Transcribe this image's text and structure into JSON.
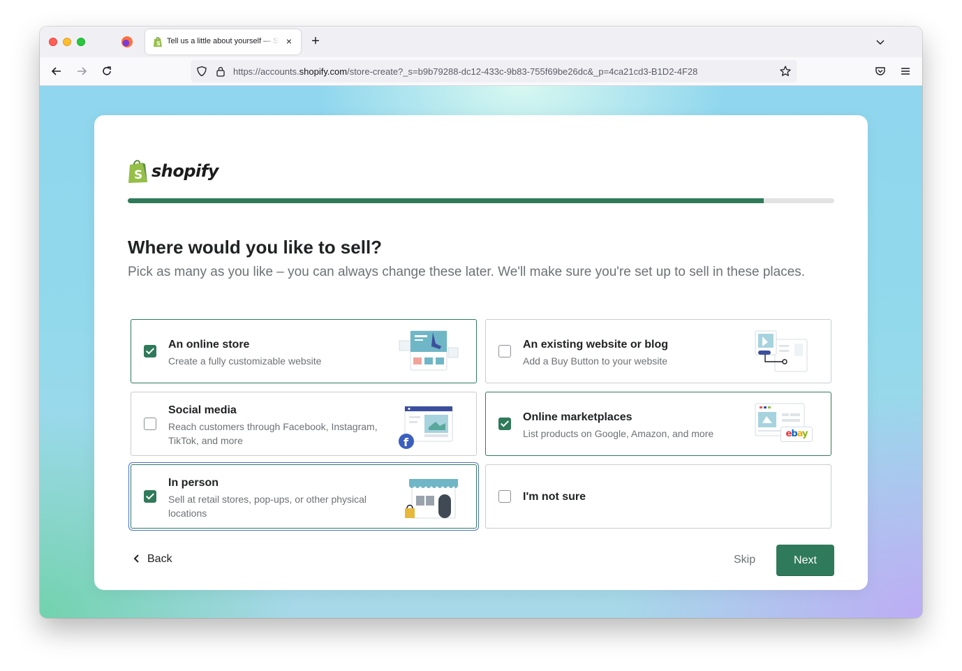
{
  "browser": {
    "tab_title": "Tell us a little about yourself — Shopify",
    "url_prefix": "https://accounts.",
    "url_host": "shopify.com",
    "url_path": "/store-create?_s=b9b79288-dc12-433c-9b83-755f69be26dc&_p=4ca21cd3-B1D2-4F28"
  },
  "brand": {
    "name": "shopify",
    "color": "#2f7a5a",
    "bag_color": "#95bf47"
  },
  "progress": {
    "value_percent": 90
  },
  "page": {
    "heading": "Where would you like to sell?",
    "subtitle": "Pick as many as you like – you can always change these later. We'll make sure you're set up to sell in these places."
  },
  "options": [
    {
      "title": "An online store",
      "description": "Create a fully customizable website",
      "checked": true,
      "icon": "online-store-illustration"
    },
    {
      "title": "An existing website or blog",
      "description": "Add a Buy Button to your website",
      "checked": false,
      "icon": "website-blog-illustration"
    },
    {
      "title": "Social media",
      "description": "Reach customers through Facebook, Instagram, TikTok, and more",
      "checked": false,
      "icon": "social-media-illustration"
    },
    {
      "title": "Online marketplaces",
      "description": "List products on Google, Amazon, and more",
      "checked": true,
      "icon": "marketplaces-illustration",
      "badge": "ebay"
    },
    {
      "title": "In person",
      "description": "Sell at retail stores, pop-ups, or other physical locations",
      "checked": true,
      "icon": "in-person-illustration"
    },
    {
      "title": "I'm not sure",
      "description": "",
      "checked": false,
      "icon": ""
    }
  ],
  "footer": {
    "back_label": "Back",
    "skip_label": "Skip",
    "next_label": "Next"
  }
}
